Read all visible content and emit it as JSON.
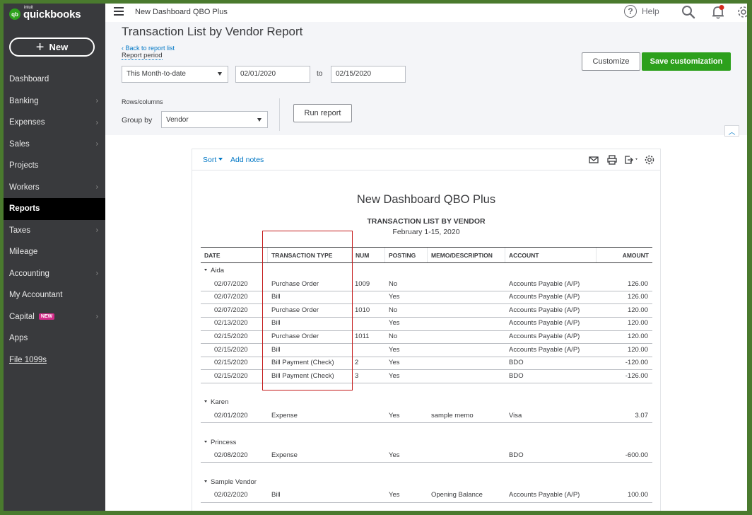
{
  "app": {
    "logo_small": "qb",
    "logo_intuit": "intuit",
    "logo_text": "quickbooks",
    "company_name": "New Dashboard QBO Plus",
    "help_label": "Help",
    "colors": {
      "brand_green": "#2ca01c",
      "sidebar": "#393a3d",
      "link": "#0077c5",
      "frame": "#4a7a2e"
    }
  },
  "sidebar": {
    "new_button_label": "New",
    "items": [
      {
        "label": "Dashboard",
        "chevron": false
      },
      {
        "label": "Banking",
        "chevron": true
      },
      {
        "label": "Expenses",
        "chevron": true
      },
      {
        "label": "Sales",
        "chevron": true
      },
      {
        "label": "Projects",
        "chevron": false
      },
      {
        "label": "Workers",
        "chevron": true
      },
      {
        "label": "Reports",
        "chevron": false,
        "active": true
      },
      {
        "label": "Taxes",
        "chevron": true
      },
      {
        "label": "Mileage",
        "chevron": false
      },
      {
        "label": "Accounting",
        "chevron": true
      },
      {
        "label": "My Accountant",
        "chevron": false
      },
      {
        "label": "Capital",
        "chevron": true,
        "badge": "NEW"
      },
      {
        "label": "Apps",
        "chevron": false
      },
      {
        "label": "File 1099s",
        "chevron": false,
        "underline": true
      }
    ]
  },
  "header": {
    "title": "Transaction List by Vendor Report",
    "back_link": "Back to report list",
    "report_period_label": "Report period",
    "period_value": "This Month-to-date",
    "date_from": "02/01/2020",
    "to_label": "to",
    "date_to": "02/15/2020",
    "customize_label": "Customize",
    "save_label": "Save customization",
    "rows_columns_label": "Rows/columns",
    "group_by_label": "Group by",
    "group_by_value": "Vendor",
    "run_report_label": "Run report"
  },
  "report": {
    "toolbar": {
      "sort_label": "Sort",
      "add_notes_label": "Add notes"
    },
    "company": "New Dashboard QBO Plus",
    "title": "TRANSACTION LIST BY VENDOR",
    "date_range": "February 1-15, 2020",
    "columns": [
      "DATE",
      "TRANSACTION TYPE",
      "NUM",
      "POSTING",
      "MEMO/DESCRIPTION",
      "ACCOUNT",
      "AMOUNT"
    ],
    "groups": [
      {
        "vendor": "Aida",
        "rows": [
          {
            "date": "02/07/2020",
            "type": "Purchase Order",
            "num": "1009",
            "posting": "No",
            "memo": "",
            "account": "Accounts Payable (A/P)",
            "amount": "126.00"
          },
          {
            "date": "02/07/2020",
            "type": "Bill",
            "num": "",
            "posting": "Yes",
            "memo": "",
            "account": "Accounts Payable (A/P)",
            "amount": "126.00"
          },
          {
            "date": "02/07/2020",
            "type": "Purchase Order",
            "num": "1010",
            "posting": "No",
            "memo": "",
            "account": "Accounts Payable (A/P)",
            "amount": "120.00"
          },
          {
            "date": "02/13/2020",
            "type": "Bill",
            "num": "",
            "posting": "Yes",
            "memo": "",
            "account": "Accounts Payable (A/P)",
            "amount": "120.00"
          },
          {
            "date": "02/15/2020",
            "type": "Purchase Order",
            "num": "1011",
            "posting": "No",
            "memo": "",
            "account": "Accounts Payable (A/P)",
            "amount": "120.00"
          },
          {
            "date": "02/15/2020",
            "type": "Bill",
            "num": "",
            "posting": "Yes",
            "memo": "",
            "account": "Accounts Payable (A/P)",
            "amount": "120.00"
          },
          {
            "date": "02/15/2020",
            "type": "Bill Payment (Check)",
            "num": "2",
            "posting": "Yes",
            "memo": "",
            "account": "BDO",
            "amount": "-120.00"
          },
          {
            "date": "02/15/2020",
            "type": "Bill Payment (Check)",
            "num": "3",
            "posting": "Yes",
            "memo": "",
            "account": "BDO",
            "amount": "-126.00"
          }
        ]
      },
      {
        "vendor": "Karen",
        "rows": [
          {
            "date": "02/01/2020",
            "type": "Expense",
            "num": "",
            "posting": "Yes",
            "memo": "sample memo",
            "account": "Visa",
            "amount": "3.07"
          }
        ]
      },
      {
        "vendor": "Princess",
        "rows": [
          {
            "date": "02/08/2020",
            "type": "Expense",
            "num": "",
            "posting": "Yes",
            "memo": "",
            "account": "BDO",
            "amount": "-600.00"
          }
        ]
      },
      {
        "vendor": "Sample Vendor",
        "rows": [
          {
            "date": "02/02/2020",
            "type": "Bill",
            "num": "",
            "posting": "Yes",
            "memo": "Opening Balance",
            "account": "Accounts Payable (A/P)",
            "amount": "100.00"
          }
        ]
      }
    ]
  }
}
